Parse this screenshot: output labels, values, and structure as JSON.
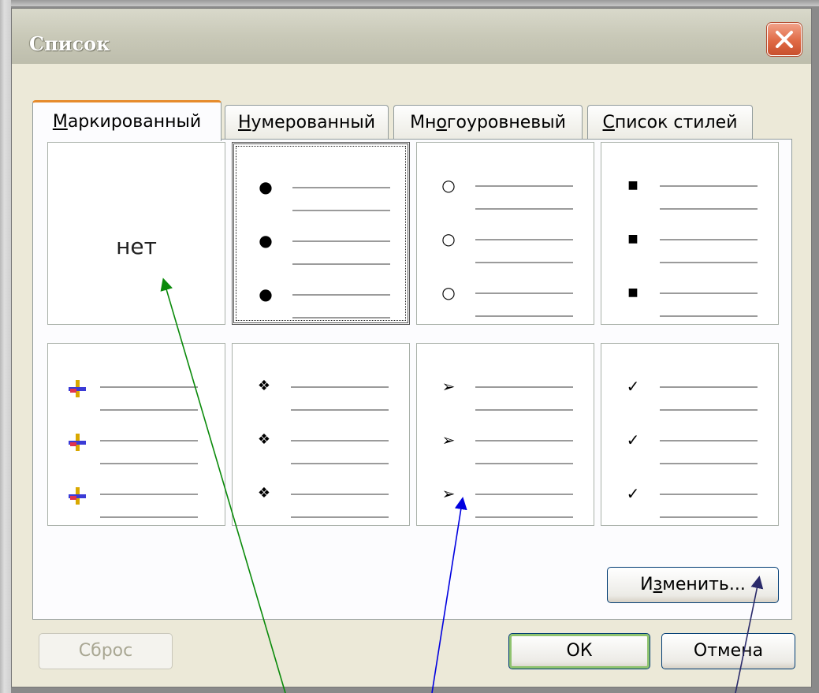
{
  "window": {
    "title": "Список"
  },
  "tabs": [
    {
      "label": "Маркированный",
      "mnemonic": "М",
      "rest": "аркированный",
      "active": true
    },
    {
      "label": "Нумерованный",
      "mnemonic": "Н",
      "rest": "умерованный",
      "active": false
    },
    {
      "label": "Многоуровневый",
      "pre": "Мн",
      "mnemonic": "о",
      "rest": "гоуровневый",
      "active": false
    },
    {
      "label": "Список стилей",
      "mnemonic": "С",
      "rest": "писок стилей",
      "active": false
    }
  ],
  "gallery": {
    "none_label": "нет",
    "tiles": [
      {
        "icon": "none",
        "selected": false
      },
      {
        "icon": "filled-circle-bullet-icon",
        "glyph": "●",
        "selected": true
      },
      {
        "icon": "hollow-circle-bullet-icon",
        "glyph": "○",
        "selected": false
      },
      {
        "icon": "square-bullet-icon",
        "glyph": "■",
        "selected": false
      },
      {
        "icon": "colored-plus-bullet-icon",
        "glyph": "+",
        "selected": false
      },
      {
        "icon": "four-diamond-bullet-icon",
        "glyph": "❖",
        "selected": false
      },
      {
        "icon": "arrowhead-bullet-icon",
        "glyph": "➢",
        "selected": false
      },
      {
        "icon": "checkmark-bullet-icon",
        "glyph": "✓",
        "selected": false
      }
    ]
  },
  "buttons": {
    "customize": {
      "label": "Изменить...",
      "pre": "И",
      "mnemonic": "з",
      "rest": "менить..."
    },
    "reset": {
      "label": "Сброс"
    },
    "ok": {
      "label": "ОК"
    },
    "cancel": {
      "label": "Отмена"
    }
  },
  "colors": {
    "annotation_green": "#0a8a0a",
    "annotation_blue": "#0000e0",
    "annotation_dark": "#2a2a6a",
    "tab_active_accent": "#e68b2c",
    "close_button": "#e06a45"
  }
}
